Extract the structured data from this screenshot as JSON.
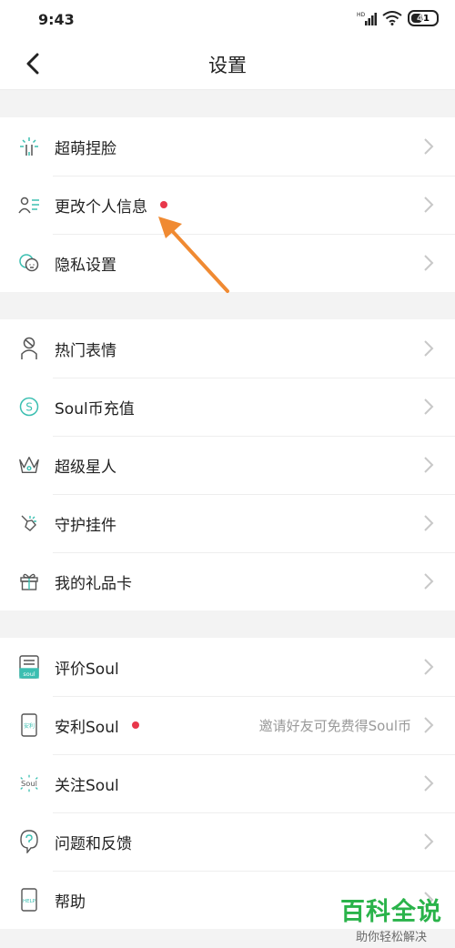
{
  "status": {
    "time": "9:43",
    "battery": "41"
  },
  "nav": {
    "title": "设置"
  },
  "groups": [
    {
      "items": [
        {
          "label": "超萌捏脸",
          "icon": "face-sparkle-icon"
        },
        {
          "label": "更改个人信息",
          "icon": "profile-list-icon",
          "dot": true
        },
        {
          "label": "隐私设置",
          "icon": "privacy-faces-icon"
        }
      ]
    },
    {
      "items": [
        {
          "label": "热门表情",
          "icon": "sticker-person-icon"
        },
        {
          "label": "Soul币充值",
          "icon": "soul-coin-icon"
        },
        {
          "label": "超级星人",
          "icon": "crown-icon"
        },
        {
          "label": "守护挂件",
          "icon": "guard-pendant-icon"
        },
        {
          "label": "我的礼品卡",
          "icon": "gift-icon"
        }
      ]
    },
    {
      "items": [
        {
          "label": "评价Soul",
          "icon": "rate-soul-icon"
        },
        {
          "label": "安利Soul",
          "icon": "share-phone-icon",
          "dot": true,
          "value": "邀请好友可免费得Soul币"
        },
        {
          "label": "关注Soul",
          "icon": "follow-soul-icon"
        },
        {
          "label": "问题和反馈",
          "icon": "question-bubble-icon"
        },
        {
          "label": "帮助",
          "icon": "help-phone-icon"
        }
      ]
    }
  ],
  "watermark": {
    "title": "百科全说",
    "subtitle": "助你轻松解决"
  },
  "colors": {
    "accent": "#3bbfb1",
    "dot": "#e8374b",
    "arrow": "#f08a32",
    "watermark": "#2ab34a"
  }
}
